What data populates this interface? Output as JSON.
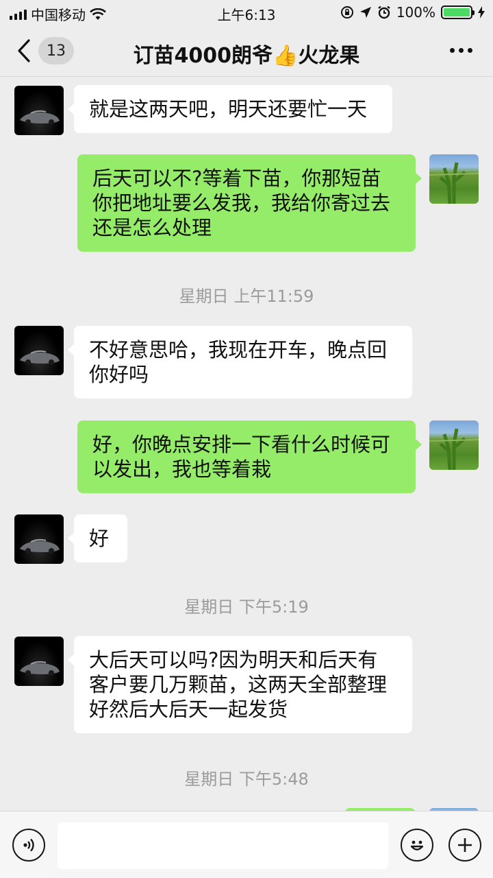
{
  "status_bar": {
    "carrier": "中国移动",
    "time": "上午6:13",
    "battery": "100%"
  },
  "nav": {
    "unread_count": "13",
    "title": "订苗4000朗爷👍火龙果"
  },
  "messages": [
    {
      "type": "in",
      "text": "就是这两天吧，明天还要忙一天"
    },
    {
      "type": "out",
      "text": "后天可以不?等着下苗，你那短苗你把地址要么发我，我给你寄过去还是怎么处理"
    },
    {
      "type": "time",
      "text": "星期日 上午11:59"
    },
    {
      "type": "in",
      "text": "不好意思哈，我现在开车，晚点回你好吗"
    },
    {
      "type": "out",
      "text": "好，你晚点安排一下看什么时候可以发出，我也等着栽"
    },
    {
      "type": "in",
      "text": "好"
    },
    {
      "type": "time",
      "text": "星期日 下午5:19"
    },
    {
      "type": "in",
      "text": "大后天可以吗?因为明天和后天有客户要几万颗苗，这两天全部整理好然后大后天一起发货"
    },
    {
      "type": "time",
      "text": "星期日 下午5:48"
    }
  ],
  "icons": {
    "back": "chevron-left-icon",
    "more": "more-icon",
    "voice": "voice-icon",
    "emoji": "emoji-icon",
    "plus": "plus-icon"
  },
  "colors": {
    "outgoing_bubble": "#95ec69",
    "incoming_bubble": "#ffffff",
    "background": "#ededed"
  }
}
